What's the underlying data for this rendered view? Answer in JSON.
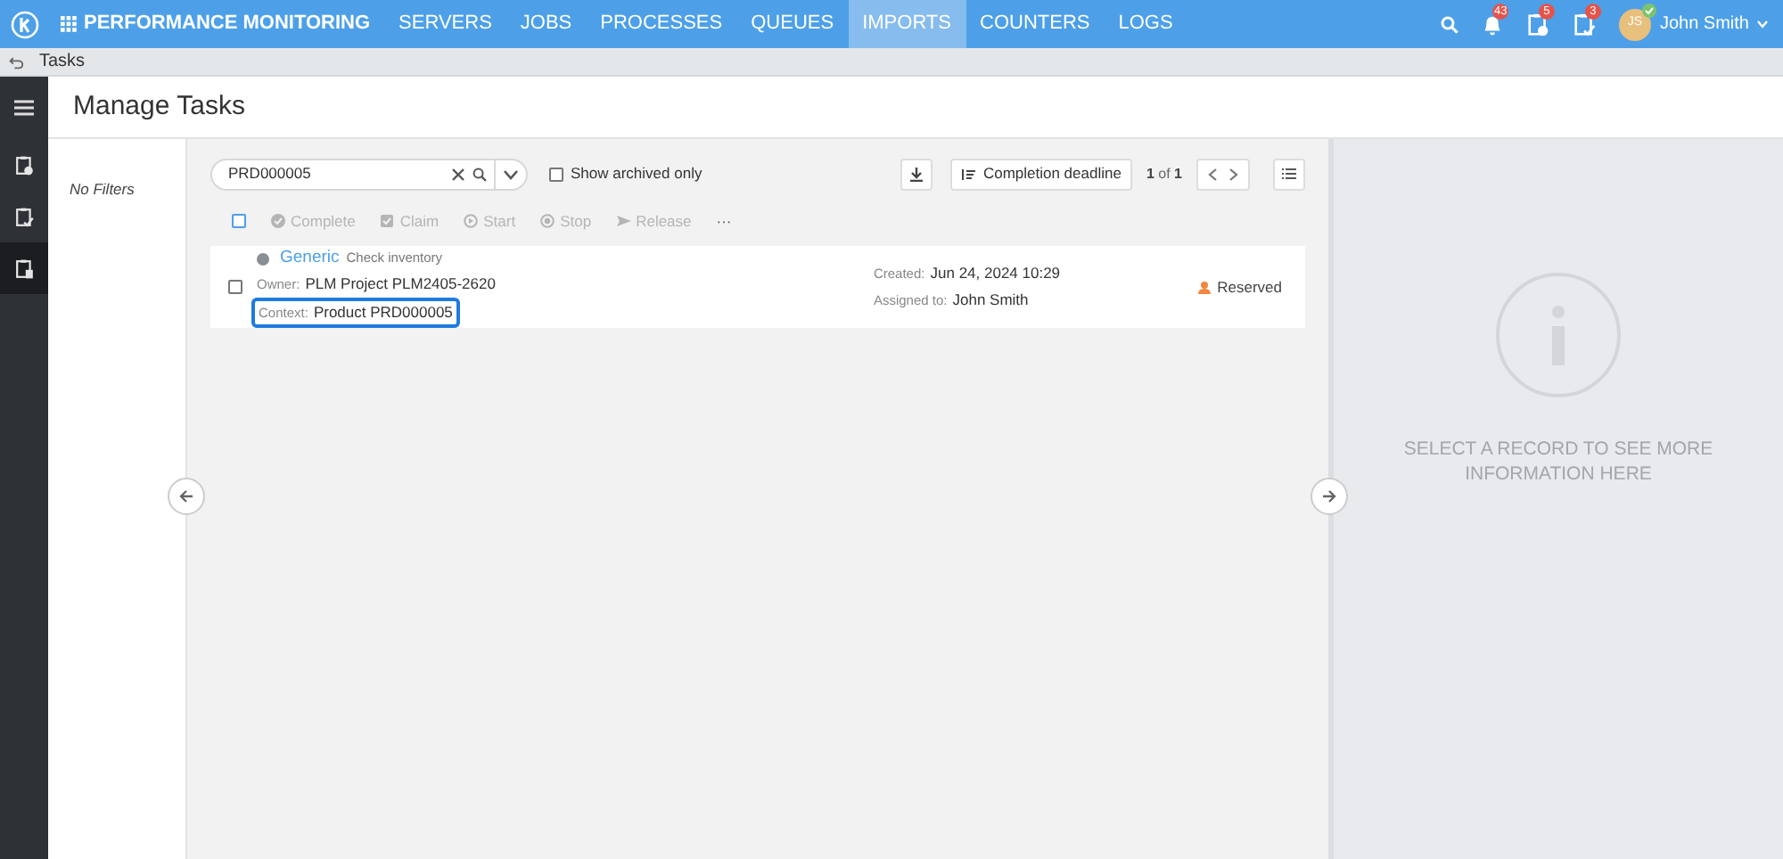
{
  "app": {
    "title": "PERFORMANCE MONITORING"
  },
  "nav": [
    {
      "label": "SERVERS",
      "selected": false
    },
    {
      "label": "JOBS",
      "selected": false
    },
    {
      "label": "PROCESSES",
      "selected": false
    },
    {
      "label": "QUEUES",
      "selected": false
    },
    {
      "label": "IMPORTS",
      "selected": true
    },
    {
      "label": "COUNTERS",
      "selected": false
    },
    {
      "label": "LOGS",
      "selected": false
    }
  ],
  "notifications": [
    {
      "kind": "bell",
      "count": "43"
    },
    {
      "kind": "clipboard-clock",
      "count": "5"
    },
    {
      "kind": "clipboard-check",
      "count": "3"
    }
  ],
  "user": {
    "initials": "JS",
    "name": "John Smith"
  },
  "breadcrumb": "Tasks",
  "rail": [
    {
      "kind": "clipboard-clock",
      "selected": false
    },
    {
      "kind": "clipboard-check",
      "selected": false
    },
    {
      "kind": "clipboard",
      "selected": true
    }
  ],
  "page_title": "Manage Tasks",
  "filters": "No Filters",
  "search": {
    "value": "PRD000005"
  },
  "archived": {
    "label": "Show archived only",
    "checked": false
  },
  "sort": "Completion deadline",
  "pager": {
    "current": "1",
    "of": "of",
    "total": "1"
  },
  "actions": [
    {
      "kind": "check",
      "label": "Complete",
      "disabled": true
    },
    {
      "kind": "claim",
      "label": "Claim",
      "disabled": true
    },
    {
      "kind": "play",
      "label": "Start",
      "disabled": true
    },
    {
      "kind": "stop",
      "label": "Stop",
      "disabled": true
    },
    {
      "kind": "send",
      "label": "Release",
      "disabled": true
    },
    {
      "kind": "more",
      "label": "···",
      "disabled": false
    }
  ],
  "select_all": {
    "checked": false
  },
  "tasks": [
    {
      "checked": false,
      "type": "Generic",
      "name": "Check inventory",
      "owner_label": "Owner:",
      "owner": "PLM Project PLM2405-2620",
      "context_label": "Context:",
      "context": "Product PRD000005",
      "highlighted": true,
      "created_label": "Created:",
      "created": "Jun 24, 2024 10:29",
      "assigned_label": "Assigned to:",
      "assigned": "John Smith",
      "status": "Reserved"
    }
  ],
  "details": {
    "message": "SELECT A RECORD TO SEE MORE INFORMATION HERE"
  }
}
